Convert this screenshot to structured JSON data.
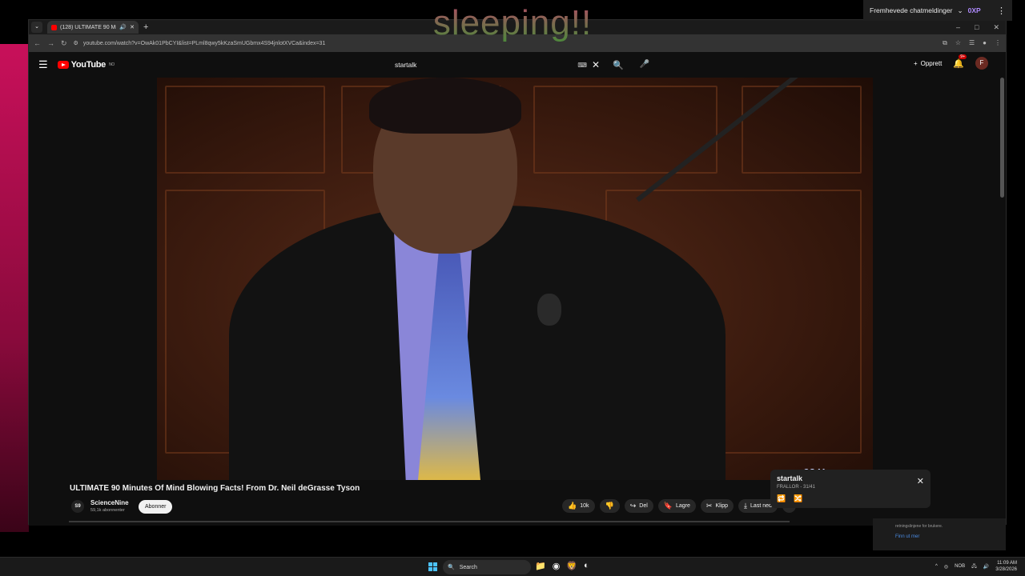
{
  "overlay": {
    "text": "sleeping!!"
  },
  "chat_pill": {
    "label": "Fremhevede chatmeldinger",
    "badge": "0XP"
  },
  "browser": {
    "tab_title": "(128) ULTIMATE 90 Minutes",
    "url": "youtube.com/watch?v=OwAk01PbCYI&list=PLml8qwy5kKzaSmUGbmx4S94jnlotXVCa&index=31"
  },
  "youtube": {
    "logo_text": "YouTube",
    "logo_region": "NO",
    "search_query": "startalk",
    "create_label": "Opprett",
    "notif_count": "9+",
    "avatar_letter": "F"
  },
  "video": {
    "caption_mark": "92 Y",
    "title": "ULTIMATE 90 Minutes Of Mind Blowing Facts! From Dr. Neil deGrasse Tyson",
    "channel": "ScienceNine",
    "channel_initials": "S9",
    "subscribers": "59,1k abonnenter",
    "subscribe_label": "Abonner",
    "actions": {
      "like": "10k",
      "share": "Del",
      "save": "Lagre",
      "clip": "Klipp",
      "download": "Last ned"
    }
  },
  "playlist": {
    "title": "startalk",
    "subtitle": "FRALLOR - 31/41"
  },
  "notification": {
    "text": "retningslinjene for brukere.",
    "link": "Finn ut mer"
  },
  "taskbar": {
    "search_label": "Search",
    "lang": "NOB",
    "time": "11:09 AM",
    "date": "3/28/2026"
  }
}
